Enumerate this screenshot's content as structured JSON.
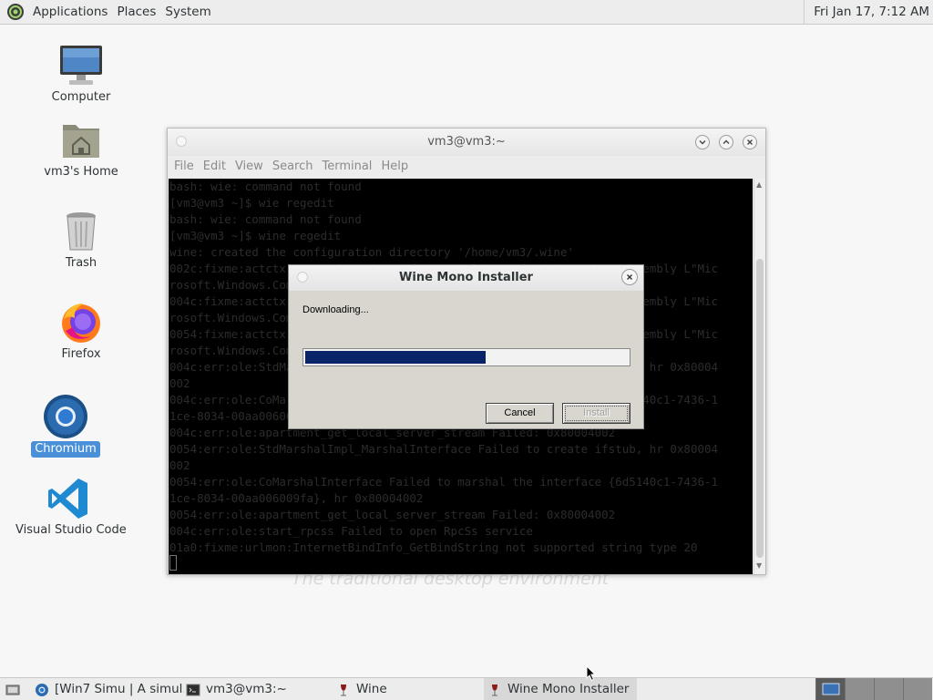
{
  "top_panel": {
    "menus": [
      "Applications",
      "Places",
      "System"
    ],
    "clock": "Fri Jan 17,  7:12 AM"
  },
  "desktop": {
    "icons": [
      {
        "label": "Computer",
        "icon": "computer-icon"
      },
      {
        "label": "vm3's Home",
        "icon": "home-folder-icon"
      },
      {
        "label": "Trash",
        "icon": "trash-icon"
      },
      {
        "label": "Firefox",
        "icon": "firefox-icon"
      },
      {
        "label": "Chromium",
        "icon": "chromium-icon",
        "selected": true
      },
      {
        "label": "Visual Studio Code",
        "icon": "vscode-icon"
      }
    ],
    "tagline": "The traditional desktop environment"
  },
  "terminal": {
    "title": "vm3@vm3:~",
    "menu": [
      "File",
      "Edit",
      "View",
      "Search",
      "Terminal",
      "Help"
    ],
    "lines": [
      "bash: wie: command not found",
      "[vm3@vm3 ~]$ wie regedit",
      "bash: wie: command not found",
      "[vm3@vm3 ~]$ wine regedit",
      "wine: created the configuration directory '/home/vm3/.wine'",
      "002c:fixme:actctx:parse_depend_manifests Could not find dependent assembly L\"Mic",
      "rosoft.Windows.Common-Controls\"",
      "004c:fixme:actctx:parse_depend_manifests Could not find dependent assembly L\"Mic",
      "rosoft.Windows.Common-Controls\"",
      "0054:fixme:actctx:parse_depend_manifests Could not find dependent assembly L\"Mic",
      "rosoft.Windows.Common-Controls\"",
      "004c:err:ole:StdMarshalImpl_MarshalInterface Failed to create ifstub, hr 0x80004",
      "002",
      "004c:err:ole:CoMarshalInterface Failed to marshal the interface {6d5140c1-7436-1",
      "1ce-8034-00aa006009fa}, hr 0x80004002",
      "004c:err:ole:apartment_get_local_server_stream Failed: 0x80004002",
      "0054:err:ole:StdMarshalImpl_MarshalInterface Failed to create ifstub, hr 0x80004",
      "002",
      "0054:err:ole:CoMarshalInterface Failed to marshal the interface {6d5140c1-7436-1",
      "1ce-8034-00aa006009fa}, hr 0x80004002",
      "0054:err:ole:apartment_get_local_server_stream Failed: 0x80004002",
      "004c:err:ole:start_rpcss Failed to open RpcSs service",
      "01a0:fixme:urlmon:InternetBindInfo_GetBindString not supported string type 20"
    ]
  },
  "dialog": {
    "title": "Wine Mono Installer",
    "status": "Downloading...",
    "progress": 0.56,
    "cancel_label": "Cancel",
    "install_label": "Install"
  },
  "taskbar": {
    "tasks": [
      {
        "label": "[Win7 Simu | A simul...",
        "icon": "chromium-icon"
      },
      {
        "label": "vm3@vm3:~",
        "icon": "terminal-icon"
      },
      {
        "label": "Wine",
        "icon": "wine-icon"
      },
      {
        "label": "Wine Mono Installer",
        "icon": "wine-icon",
        "active": true
      }
    ],
    "workspaces": 4,
    "active_workspace": 1
  },
  "colors": {
    "progress_fill": "#0a246a",
    "selection": "#4a90d9",
    "terminal_bg": "#000000"
  }
}
